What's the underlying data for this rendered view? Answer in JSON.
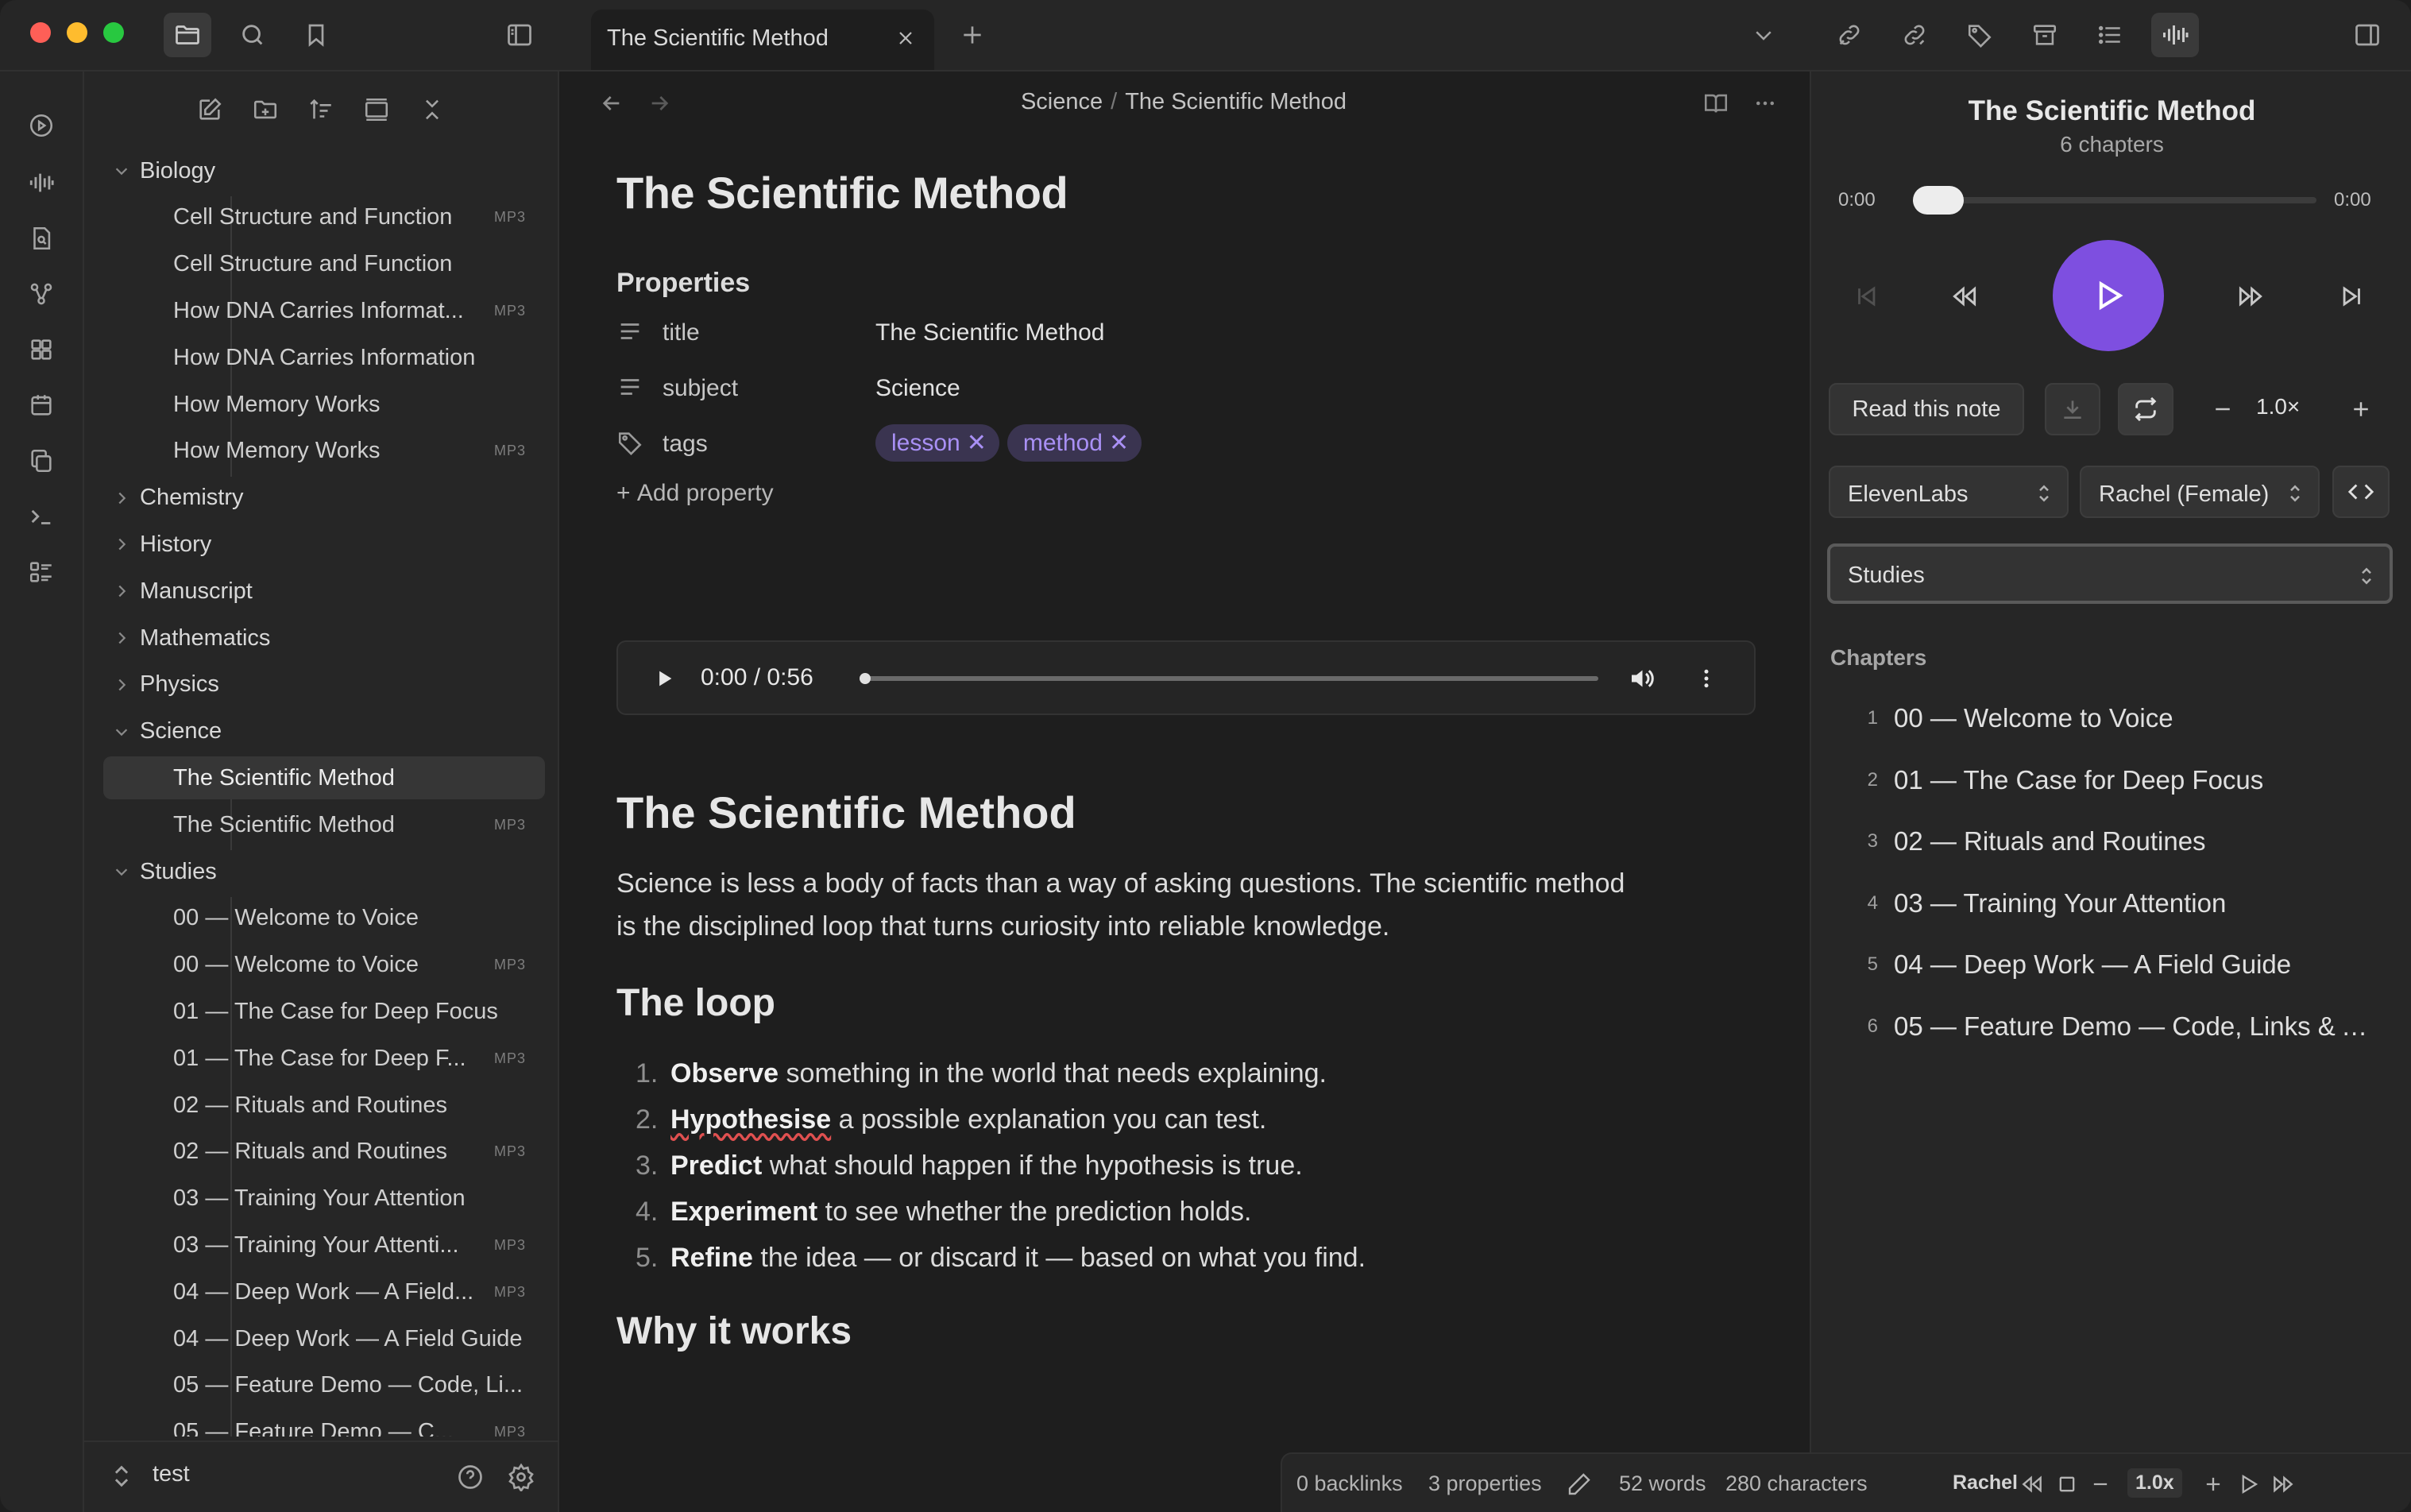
{
  "window": {
    "tab_title": "The Scientific Method"
  },
  "sidebar": {
    "tree": [
      {
        "type": "folder",
        "label": "Biology",
        "open": true
      },
      {
        "type": "file",
        "label": "Cell Structure and Function",
        "badge": "MP3"
      },
      {
        "type": "file",
        "label": "Cell Structure and Function",
        "badge": ""
      },
      {
        "type": "file",
        "label": "How DNA Carries Informat...",
        "badge": "MP3"
      },
      {
        "type": "file",
        "label": "How DNA Carries Information",
        "badge": ""
      },
      {
        "type": "file",
        "label": "How Memory Works",
        "badge": ""
      },
      {
        "type": "file",
        "label": "How Memory Works",
        "badge": "MP3"
      },
      {
        "type": "folder",
        "label": "Chemistry",
        "open": false
      },
      {
        "type": "folder",
        "label": "History",
        "open": false
      },
      {
        "type": "folder",
        "label": "Manuscript",
        "open": false
      },
      {
        "type": "folder",
        "label": "Mathematics",
        "open": false
      },
      {
        "type": "folder",
        "label": "Physics",
        "open": false
      },
      {
        "type": "folder",
        "label": "Science",
        "open": true
      },
      {
        "type": "file",
        "label": "The Scientific Method",
        "badge": "",
        "selected": true
      },
      {
        "type": "file",
        "label": "The Scientific Method",
        "badge": "MP3"
      },
      {
        "type": "folder",
        "label": "Studies",
        "open": true
      },
      {
        "type": "file",
        "label": "00 — Welcome to Voice",
        "badge": ""
      },
      {
        "type": "file",
        "label": "00 — Welcome to Voice",
        "badge": "MP3"
      },
      {
        "type": "file",
        "label": "01 — The Case for Deep Focus",
        "badge": ""
      },
      {
        "type": "file",
        "label": "01 — The Case for Deep F...",
        "badge": "MP3"
      },
      {
        "type": "file",
        "label": "02 — Rituals and Routines",
        "badge": ""
      },
      {
        "type": "file",
        "label": "02 — Rituals and Routines",
        "badge": "MP3"
      },
      {
        "type": "file",
        "label": "03 — Training Your Attention",
        "badge": ""
      },
      {
        "type": "file",
        "label": "03 — Training Your Attenti...",
        "badge": "MP3"
      },
      {
        "type": "file",
        "label": "04 — Deep Work — A Field...",
        "badge": "MP3"
      },
      {
        "type": "file",
        "label": "04 — Deep Work — A Field Guide",
        "badge": ""
      },
      {
        "type": "file",
        "label": "05 — Feature Demo — Code, Li...",
        "badge": ""
      },
      {
        "type": "file",
        "label": "05 — Feature Demo — C...",
        "badge": "MP3"
      }
    ],
    "vault_name": "test"
  },
  "editor": {
    "breadcrumb": {
      "folder": "Science",
      "sep": "/",
      "note": "The Scientific Method"
    },
    "title": "The Scientific Method",
    "properties_heading": "Properties",
    "properties": {
      "title": {
        "key": "title",
        "value": "The Scientific Method"
      },
      "subject": {
        "key": "subject",
        "value": "Science"
      },
      "tags": {
        "key": "tags",
        "values": [
          "lesson",
          "method"
        ]
      }
    },
    "add_property": "Add property",
    "audio": {
      "time": "0:00 / 0:56",
      "progress": 0.0
    },
    "heading": "The Scientific Method",
    "intro": "Science is less a body of facts than a way of asking questions. The scientific method is the disciplined loop that turns curiosity into reliable knowledge.",
    "loop_heading": "The loop",
    "steps": [
      {
        "num": "1.",
        "bold": "Observe",
        "rest": " something in the world that needs explaining."
      },
      {
        "num": "2.",
        "bold": "Hypothesise",
        "rest": " a possible explanation you can test."
      },
      {
        "num": "3.",
        "bold": "Predict",
        "rest": " what should happen if the hypothesis is true."
      },
      {
        "num": "4.",
        "bold": "Experiment",
        "rest": " to see whether the prediction holds."
      },
      {
        "num": "5.",
        "bold": "Refine",
        "rest": " the idea — or discard it — based on what you find."
      }
    ],
    "why_heading": "Why it works"
  },
  "status_bar": {
    "backlinks": "0 backlinks",
    "properties": "3 properties",
    "words": "52 words",
    "characters": "280 characters",
    "voice": "Rachel",
    "speed": "1.0x"
  },
  "player": {
    "title": "The Scientific Method",
    "subtitle": "6 chapters",
    "time_start": "0:00",
    "time_end": "0:00",
    "progress": 0.0,
    "read_note": "Read this note",
    "speed": "1.0×",
    "provider": "ElevenLabs",
    "voice": "Rachel (Female)",
    "collection": "Studies",
    "chapters_heading": "Chapters",
    "chapters": [
      {
        "num": "1",
        "title": "00 — Welcome to Voice"
      },
      {
        "num": "2",
        "title": "01 — The Case for Deep Focus"
      },
      {
        "num": "3",
        "title": "02 — Rituals and Routines"
      },
      {
        "num": "4",
        "title": "03 — Training Your Attention"
      },
      {
        "num": "5",
        "title": "04 — Deep Work — A Field Guide"
      },
      {
        "num": "6",
        "title": "05 — Feature Demo — Code, Links & A..."
      }
    ]
  },
  "colors": {
    "accent": "#7e4fe0",
    "tag_text": "#a990f5",
    "tag_bg": "#3a3450",
    "background": "#1e1e1e",
    "panel": "#262626"
  }
}
